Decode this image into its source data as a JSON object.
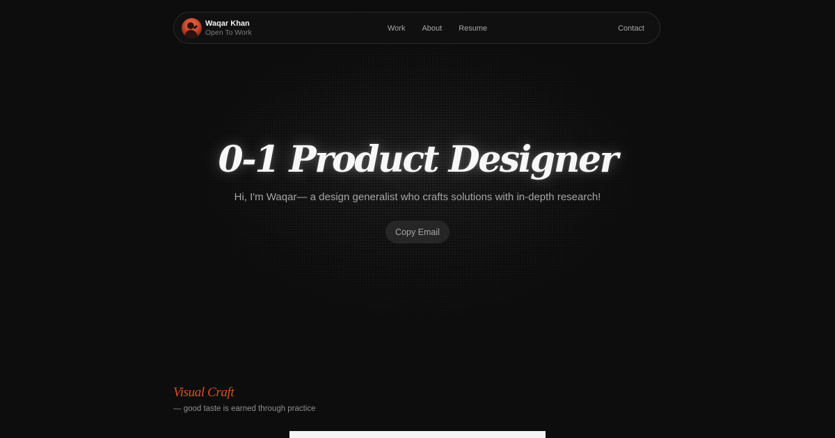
{
  "nav": {
    "brand": {
      "name": "Waqar Khan",
      "status": "Open To Work",
      "avatar_icon": "profile-photo"
    },
    "links": [
      {
        "label": "Work"
      },
      {
        "label": "About"
      },
      {
        "label": "Resume"
      }
    ],
    "contact_label": "Contact"
  },
  "hero": {
    "title": "0-1 Product Designer",
    "subtitle": "Hi, I'm Waqar— a design generalist who crafts solutions with in-depth research!",
    "button_label": "Copy Email"
  },
  "section": {
    "title": "Visual Craft",
    "caption": "— good taste is earned through practice"
  },
  "colors": {
    "background": "#0d0d0d",
    "accent": "#d9502a",
    "text_primary": "#f7f7f7",
    "text_muted": "#a6a6a6",
    "button_bg": "#262626"
  }
}
